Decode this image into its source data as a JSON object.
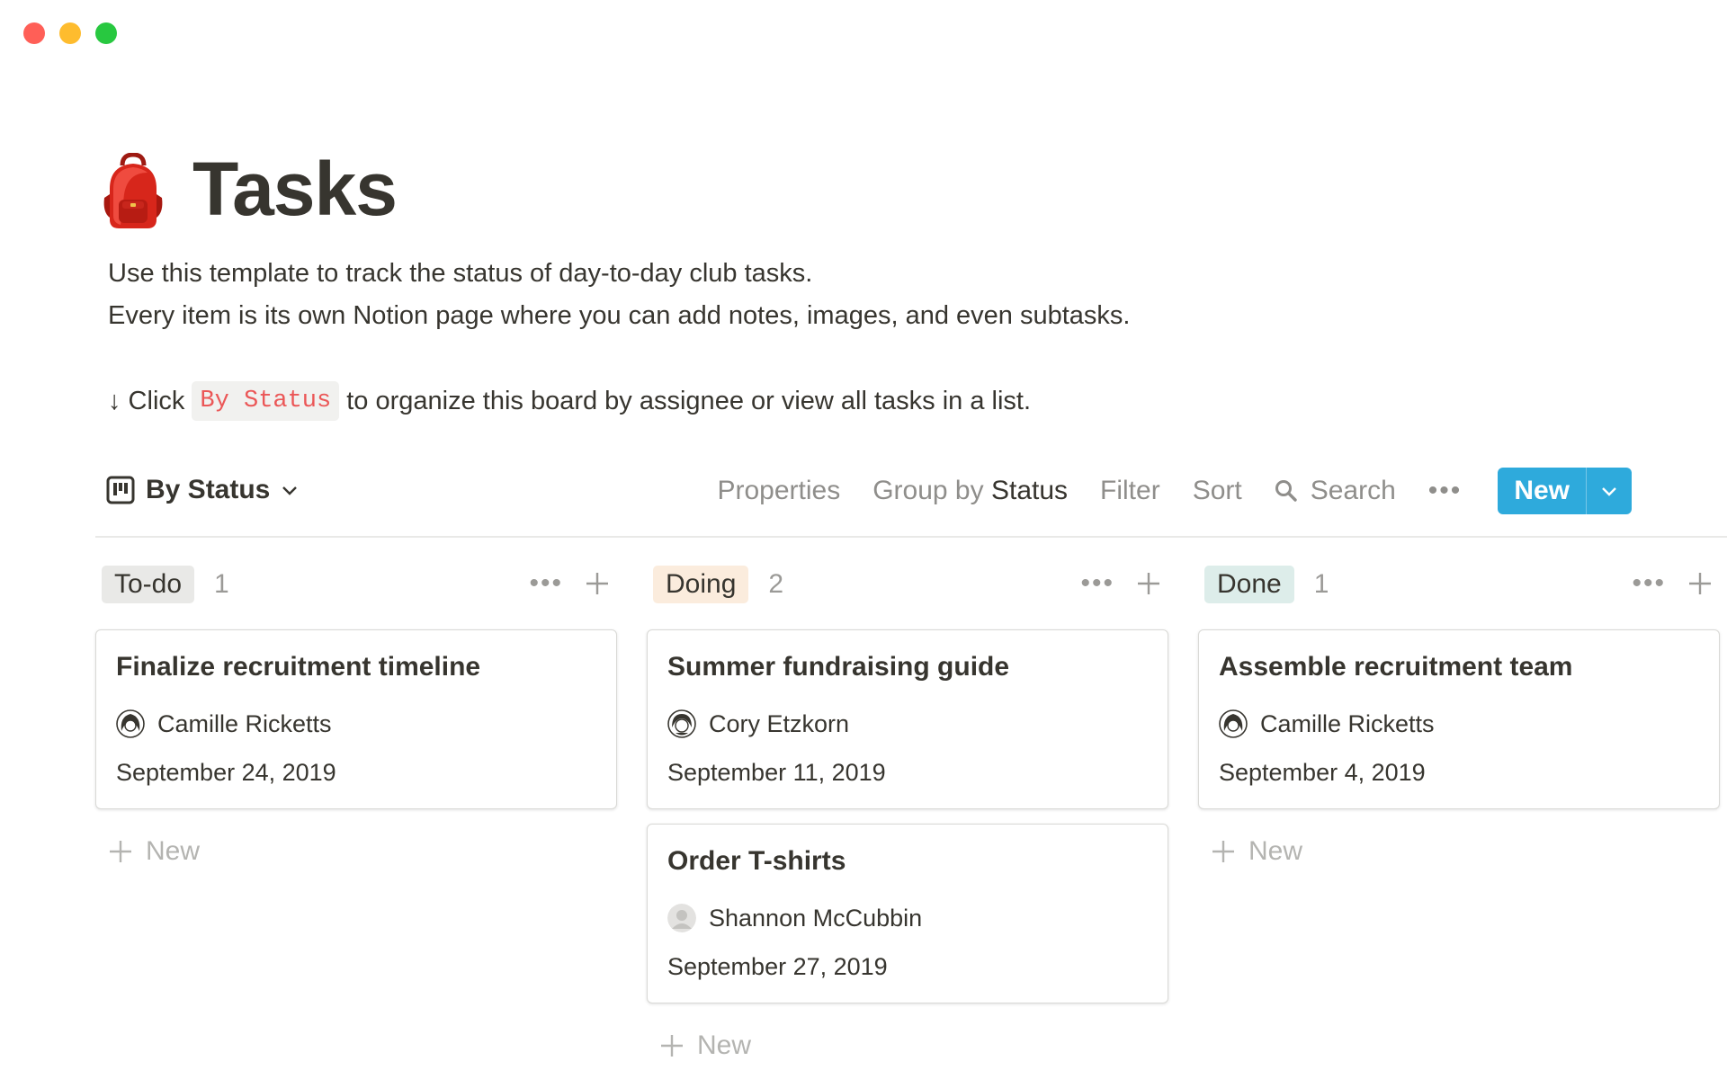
{
  "window": {
    "traffic_lights": [
      "#ff5f57",
      "#febc2e",
      "#28c840"
    ]
  },
  "page": {
    "icon": "backpack-icon",
    "title": "Tasks",
    "description_line1": "Use this template to track the status of day-to-day club tasks.",
    "description_line2": "Every item is its own Notion page where you can add notes, images, and even subtasks.",
    "hint_prefix": "↓ Click",
    "hint_code": "By Status",
    "hint_suffix": "to organize this board by assignee or view all tasks in a list."
  },
  "toolbar": {
    "view_name": "By Status",
    "view_icon": "board-icon",
    "properties": "Properties",
    "group_by_label": "Group by",
    "group_by_value": "Status",
    "filter": "Filter",
    "sort": "Sort",
    "search": "Search",
    "more": "•••",
    "new_label": "New",
    "accent": "#2eaadc"
  },
  "board": {
    "columns": [
      {
        "status": "To-do",
        "count": "1",
        "pill_bg": "#e9e9e7",
        "pill_fg": "#37352f",
        "new_label": "New",
        "cards": [
          {
            "title": "Finalize recruitment timeline",
            "assignee": "Camille Ricketts",
            "date": "September 24, 2019"
          }
        ]
      },
      {
        "status": "Doing",
        "count": "2",
        "pill_bg": "#fbecdd",
        "pill_fg": "#37352f",
        "new_label": "New",
        "cards": [
          {
            "title": "Summer fundraising guide",
            "assignee": "Cory Etzkorn",
            "date": "September 11, 2019"
          },
          {
            "title": "Order T-shirts",
            "assignee": "Shannon McCubbin",
            "date": "September 27, 2019"
          }
        ]
      },
      {
        "status": "Done",
        "count": "1",
        "pill_bg": "#ddedea",
        "pill_fg": "#37352f",
        "new_label": "New",
        "cards": [
          {
            "title": "Assemble recruitment team",
            "assignee": "Camille Ricketts",
            "date": "September 4, 2019"
          }
        ]
      }
    ]
  }
}
